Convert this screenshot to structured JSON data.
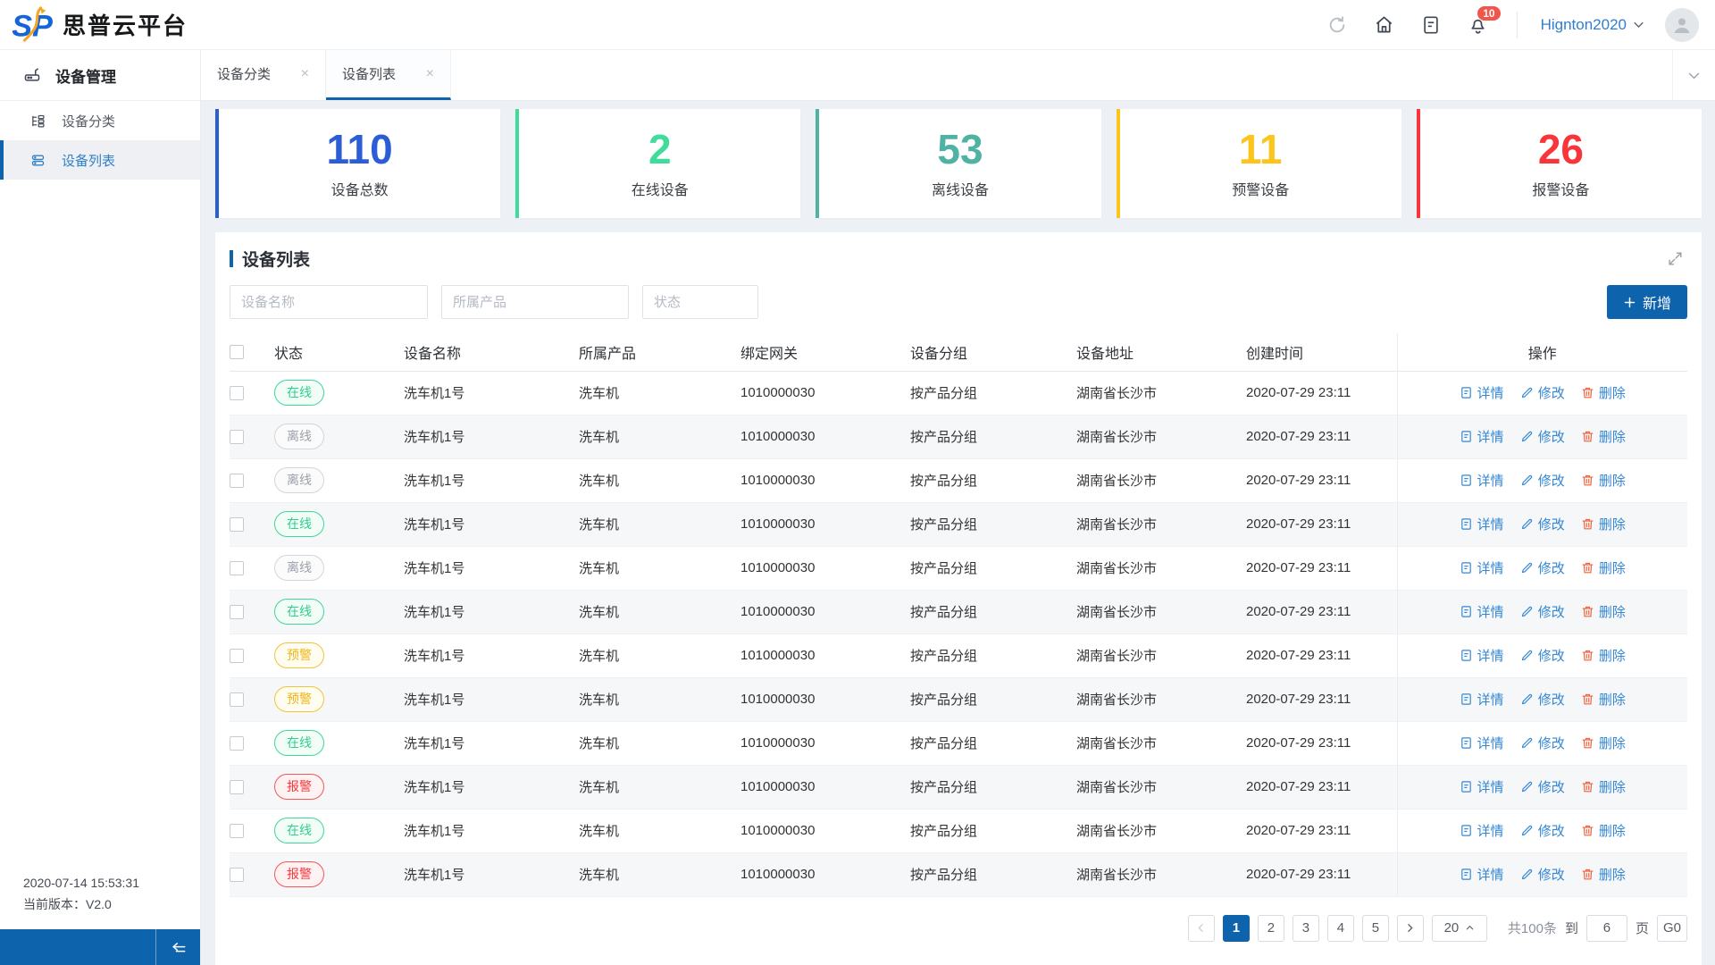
{
  "header": {
    "logo_mark": "SP",
    "logo_text": "思普云平台",
    "notification_count": "10",
    "username": "Hignton2020"
  },
  "sidebar": {
    "section_title": "设备管理",
    "items": [
      {
        "label": "设备分类"
      },
      {
        "label": "设备列表"
      }
    ],
    "footer_time": "2020-07-14 15:53:31",
    "footer_version": "当前版本：V2.0"
  },
  "tabs": [
    {
      "label": "设备分类"
    },
    {
      "label": "设备列表"
    }
  ],
  "stats": [
    {
      "value": "110",
      "label": "设备总数",
      "color": "#2c5dd5"
    },
    {
      "value": "2",
      "label": "在线设备",
      "color": "#3fdc9b"
    },
    {
      "value": "53",
      "label": "离线设备",
      "color": "#50b2a2"
    },
    {
      "value": "11",
      "label": "预警设备",
      "color": "#fcc51d"
    },
    {
      "value": "26",
      "label": "报警设备",
      "color": "#f7353b"
    }
  ],
  "panel": {
    "title": "设备列表",
    "filters": [
      {
        "placeholder": "设备名称"
      },
      {
        "placeholder": "所属产品"
      },
      {
        "placeholder": "状态"
      }
    ],
    "add_button": "新增"
  },
  "table": {
    "columns": [
      "状态",
      "设备名称",
      "所属产品",
      "绑定网关",
      "设备分组",
      "设备地址",
      "创建时间",
      "操作"
    ],
    "actions": {
      "detail": "详情",
      "edit": "修改",
      "delete": "删除"
    },
    "rows": [
      {
        "status": "在线",
        "status_type": "online",
        "name": "洗车机1号",
        "product": "洗车机",
        "gateway": "1010000030",
        "group": "按产品分组",
        "address": "湖南省长沙市",
        "created": "2020-07-29 23:11"
      },
      {
        "status": "离线",
        "status_type": "offline",
        "name": "洗车机1号",
        "product": "洗车机",
        "gateway": "1010000030",
        "group": "按产品分组",
        "address": "湖南省长沙市",
        "created": "2020-07-29 23:11"
      },
      {
        "status": "离线",
        "status_type": "offline",
        "name": "洗车机1号",
        "product": "洗车机",
        "gateway": "1010000030",
        "group": "按产品分组",
        "address": "湖南省长沙市",
        "created": "2020-07-29 23:11"
      },
      {
        "status": "在线",
        "status_type": "online",
        "name": "洗车机1号",
        "product": "洗车机",
        "gateway": "1010000030",
        "group": "按产品分组",
        "address": "湖南省长沙市",
        "created": "2020-07-29 23:11"
      },
      {
        "status": "离线",
        "status_type": "offline",
        "name": "洗车机1号",
        "product": "洗车机",
        "gateway": "1010000030",
        "group": "按产品分组",
        "address": "湖南省长沙市",
        "created": "2020-07-29 23:11"
      },
      {
        "status": "在线",
        "status_type": "online",
        "name": "洗车机1号",
        "product": "洗车机",
        "gateway": "1010000030",
        "group": "按产品分组",
        "address": "湖南省长沙市",
        "created": "2020-07-29 23:11"
      },
      {
        "status": "预警",
        "status_type": "warning",
        "name": "洗车机1号",
        "product": "洗车机",
        "gateway": "1010000030",
        "group": "按产品分组",
        "address": "湖南省长沙市",
        "created": "2020-07-29 23:11"
      },
      {
        "status": "预警",
        "status_type": "warning",
        "name": "洗车机1号",
        "product": "洗车机",
        "gateway": "1010000030",
        "group": "按产品分组",
        "address": "湖南省长沙市",
        "created": "2020-07-29 23:11"
      },
      {
        "status": "在线",
        "status_type": "online",
        "name": "洗车机1号",
        "product": "洗车机",
        "gateway": "1010000030",
        "group": "按产品分组",
        "address": "湖南省长沙市",
        "created": "2020-07-29 23:11"
      },
      {
        "status": "报警",
        "status_type": "alarm",
        "name": "洗车机1号",
        "product": "洗车机",
        "gateway": "1010000030",
        "group": "按产品分组",
        "address": "湖南省长沙市",
        "created": "2020-07-29 23:11"
      },
      {
        "status": "在线",
        "status_type": "online",
        "name": "洗车机1号",
        "product": "洗车机",
        "gateway": "1010000030",
        "group": "按产品分组",
        "address": "湖南省长沙市",
        "created": "2020-07-29 23:11"
      },
      {
        "status": "报警",
        "status_type": "alarm",
        "name": "洗车机1号",
        "product": "洗车机",
        "gateway": "1010000030",
        "group": "按产品分组",
        "address": "湖南省长沙市",
        "created": "2020-07-29 23:11"
      }
    ]
  },
  "pagination": {
    "pages": [
      "1",
      "2",
      "3",
      "4",
      "5"
    ],
    "active_page": "1",
    "page_size": "20",
    "total_text": "共100条",
    "to_label": "到",
    "jump_value": "6",
    "page_label": "页",
    "go_label": "G0"
  }
}
